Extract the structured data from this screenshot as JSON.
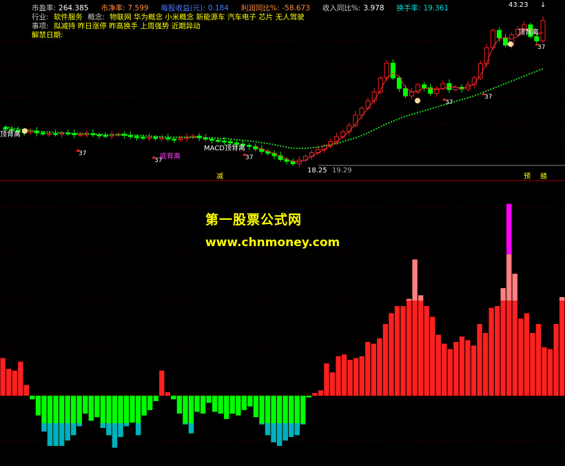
{
  "header": {
    "row1": [
      {
        "label": "市盈率:",
        "value": "264.385",
        "lc": "lbl",
        "vc": "val-white"
      },
      {
        "label": "市净率:",
        "value": "7.599",
        "lc": "val-orange",
        "vc": "val-orange"
      },
      {
        "label": "每股收益(元):",
        "value": "0.184",
        "lc": "val-blue",
        "vc": "val-blue"
      },
      {
        "label": "利润同比%:",
        "value": "-58.673",
        "lc": "val-orange",
        "vc": "val-orange"
      },
      {
        "label": "收入同比%:",
        "value": "3.978",
        "lc": "lbl",
        "vc": "val-white"
      },
      {
        "label": "换手率:",
        "value": "19.361",
        "lc": "val-cyan",
        "vc": "val-cyan"
      }
    ],
    "row2": {
      "industry_label": "行业:",
      "industry": "软件服务",
      "concept_label": "概念:",
      "concepts": "物联网 华为概念 小米概念 新能源车 汽车电子 芯片 无人驾驶"
    },
    "row3": {
      "label": "事项:",
      "text": "拟减持 昨日涨停 昨高换手 上周强势 近期异动"
    },
    "row4": {
      "label": "解禁日期:"
    }
  },
  "watermark": {
    "line1": "第一股票公式网",
    "line2": "www.chnmoney.com"
  },
  "annotations": {
    "price_high": "43.23",
    "price_low_marker": "18.25",
    "price_low": "19.29",
    "tag_37": "37",
    "top_tag": "顶背离",
    "bottom_tag": "底背离",
    "macd_tag": "MACD顶背离",
    "reduce_tag": "减",
    "pre_tag": "预",
    "jie_tag": "赣"
  },
  "colors": {
    "up": "#ff2020",
    "down": "#00ff00",
    "down_dark": "#00b0c0",
    "up_light": "#ff8080",
    "up_peak": "#ff00ff",
    "ma": "#22dd22",
    "ma2": "#ff3030"
  },
  "chart_data": [
    {
      "type": "candlestick",
      "title": "",
      "close": [
        25.2,
        25.0,
        24.8,
        24.7,
        24.9,
        24.6,
        24.5,
        24.5,
        24.4,
        24.6,
        24.5,
        24.3,
        24.4,
        24.5,
        24.3,
        24.2,
        24.1,
        24.3,
        24.4,
        24.2,
        24.0,
        23.9,
        23.8,
        23.9,
        23.7,
        23.8,
        23.6,
        23.5,
        23.7,
        23.9,
        24.1,
        23.8,
        23.6,
        23.4,
        23.3,
        23.2,
        23.0,
        22.8,
        22.6,
        22.4,
        22.0,
        21.6,
        21.3,
        20.9,
        20.3,
        20.0,
        19.6,
        20.2,
        20.8,
        21.4,
        21.9,
        22.5,
        23.2,
        24.0,
        24.8,
        25.8,
        27.5,
        28.6,
        29.8,
        31.2,
        33.5,
        35.9,
        33.5,
        31.8,
        30.6,
        31.2,
        32.4,
        31.9,
        31.0,
        31.8,
        32.6,
        31.6,
        32.0,
        31.7,
        32.4,
        33.5,
        35.8,
        38.4,
        41.2,
        40.0,
        38.8,
        40.5,
        41.4,
        42.1,
        40.2,
        39.5,
        42.8
      ],
      "ma": [
        25.6,
        25.4,
        25.2,
        25.1,
        25.0,
        24.9,
        24.8,
        24.7,
        24.7,
        24.6,
        24.6,
        24.5,
        24.5,
        24.5,
        24.4,
        24.4,
        24.3,
        24.3,
        24.3,
        24.3,
        24.2,
        24.2,
        24.1,
        24.1,
        24.0,
        24.0,
        23.9,
        23.9,
        23.9,
        23.9,
        23.9,
        23.9,
        23.8,
        23.8,
        23.7,
        23.7,
        23.6,
        23.5,
        23.4,
        23.3,
        23.2,
        23.0,
        22.9,
        22.7,
        22.5,
        22.3,
        22.1,
        22.1,
        22.1,
        22.2,
        22.3,
        22.5,
        22.7,
        22.9,
        23.2,
        23.5,
        23.8,
        24.2,
        24.6,
        25.1,
        25.6,
        26.1,
        26.5,
        26.9,
        27.3,
        27.6,
        27.9,
        28.2,
        28.5,
        28.8,
        29.1,
        29.4,
        29.7,
        30.0,
        30.3,
        30.6,
        31.0,
        31.4,
        31.8,
        32.2,
        32.6,
        33.0,
        33.4,
        33.8,
        34.2,
        34.6,
        35.0
      ],
      "price_labels": {
        "high": 43.23,
        "low": 18.25,
        "ref": 19.29
      }
    },
    {
      "type": "bar",
      "title": "",
      "values": [
        42,
        30,
        28,
        38,
        12,
        -4,
        -22,
        -40,
        -56,
        -56,
        -56,
        -50,
        -44,
        -34,
        -20,
        -28,
        -24,
        -36,
        -44,
        -58,
        -46,
        -34,
        -30,
        -44,
        -22,
        -16,
        -6,
        28,
        4,
        -4,
        -20,
        -32,
        -42,
        -18,
        -20,
        -8,
        -18,
        -20,
        -26,
        -20,
        -22,
        -16,
        -12,
        -24,
        -32,
        -44,
        -52,
        -56,
        -50,
        -46,
        -44,
        -32,
        -2,
        3,
        6,
        36,
        26,
        44,
        46,
        40,
        42,
        44,
        60,
        58,
        64,
        80,
        92,
        100,
        100,
        108,
        152,
        112,
        100,
        88,
        68,
        58,
        52,
        60,
        66,
        62,
        56,
        80,
        70,
        98,
        100,
        120,
        214,
        136,
        86,
        92,
        70,
        80,
        54,
        52,
        80,
        110
      ]
    }
  ]
}
